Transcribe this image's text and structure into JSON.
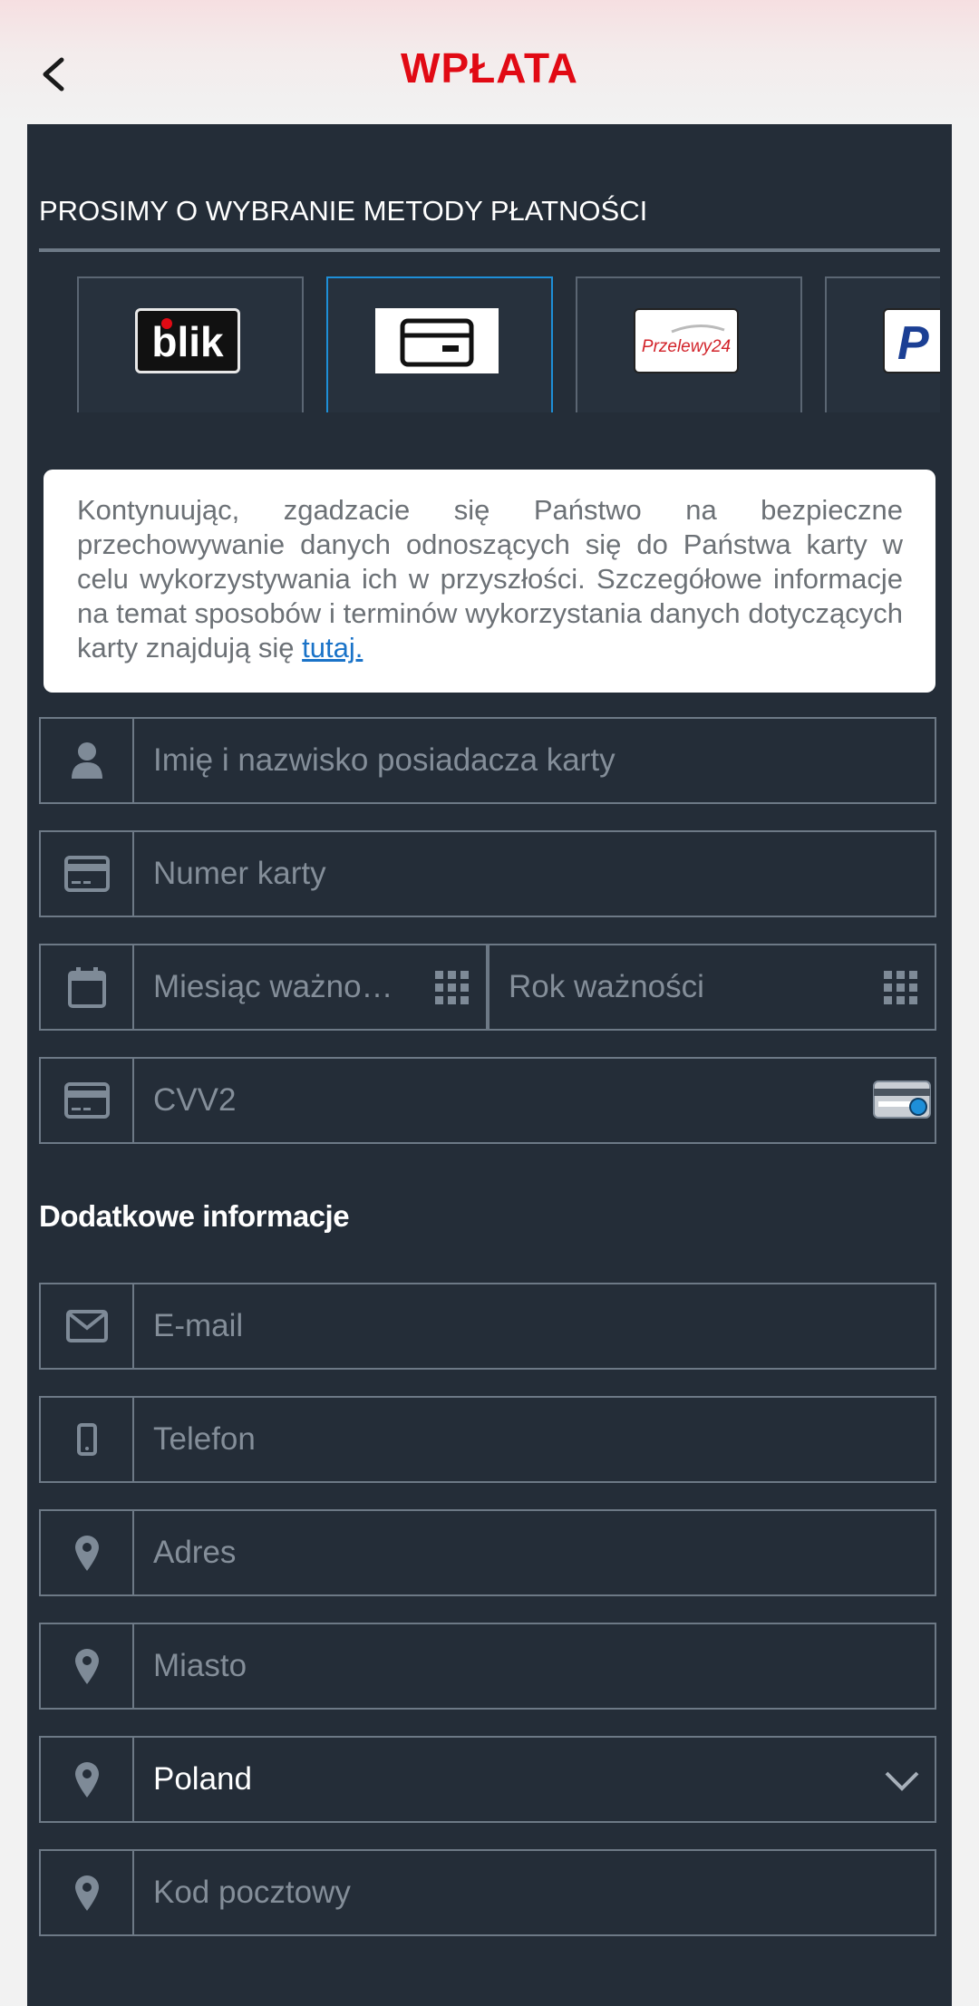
{
  "header": {
    "title": "WPŁATA"
  },
  "payment": {
    "section_title": "PROSIMY O WYBRANIE METODY PŁATNOŚCI",
    "methods": [
      {
        "name": "blik",
        "label": "blik"
      },
      {
        "name": "card",
        "label": ""
      },
      {
        "name": "przelewy24",
        "label": "Przelewy24"
      },
      {
        "name": "paypal",
        "label": "P"
      }
    ],
    "selected_method": "card"
  },
  "notice": {
    "text": "Kontynuując, zgadzacie się Państwo na bezpieczne przechowywanie danych odnoszących się do Państwa karty w celu wykorzystywania ich w przyszłości. Szczegółowe informacje na temat sposobów i terminów wykorzystania danych dotyczących karty znajdują się ",
    "link": "tutaj."
  },
  "card_form": {
    "holder_placeholder": "Imię i nazwisko posiadacza karty",
    "number_placeholder": "Numer karty",
    "month_placeholder": "Miesiąc ważno…",
    "year_placeholder": "Rok ważności",
    "cvv_placeholder": "CVV2"
  },
  "additional": {
    "title": "Dodatkowe informacje",
    "email_placeholder": "E-mail",
    "phone_placeholder": "Telefon",
    "address_placeholder": "Adres",
    "city_placeholder": "Miasto",
    "country_value": "Poland",
    "postal_placeholder": "Kod pocztowy"
  },
  "colors": {
    "accent_red": "#e10a14",
    "panel_bg": "#242d38",
    "selected_border": "#1e8fd8",
    "link": "#1a73c8"
  }
}
